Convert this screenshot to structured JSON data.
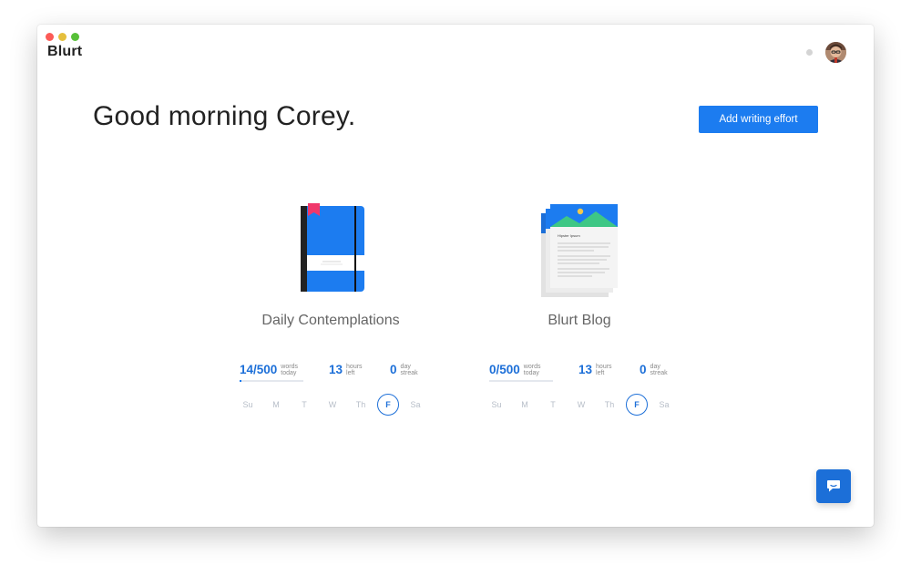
{
  "app": {
    "title": "Blurt"
  },
  "header": {
    "greeting": "Good morning Corey."
  },
  "actions": {
    "add_effort_label": "Add writing effort"
  },
  "colors": {
    "accent": "#1c7cf0",
    "accent_dark": "#1c6fd8"
  },
  "efforts": [
    {
      "title": "Daily Contemplations",
      "icon": "notebook-icon",
      "words": "14/500",
      "words_label_1": "words",
      "words_label_2": "today",
      "progress_fraction": 0.028,
      "hours": "13",
      "hours_label_1": "hours",
      "hours_label_2": "left",
      "streak": "0",
      "streak_label_1": "day",
      "streak_label_2": "streak",
      "days": [
        "Su",
        "M",
        "T",
        "W",
        "Th",
        "F",
        "Sa"
      ],
      "active_day": "F"
    },
    {
      "title": "Blurt Blog",
      "icon": "blog-pages-icon",
      "blog_preview_heading": "Hipster Ipsum",
      "words": "0/500",
      "words_label_1": "words",
      "words_label_2": "today",
      "progress_fraction": 0,
      "hours": "13",
      "hours_label_1": "hours",
      "hours_label_2": "left",
      "streak": "0",
      "streak_label_1": "day",
      "streak_label_2": "streak",
      "days": [
        "Su",
        "M",
        "T",
        "W",
        "Th",
        "F",
        "Sa"
      ],
      "active_day": "F"
    }
  ]
}
